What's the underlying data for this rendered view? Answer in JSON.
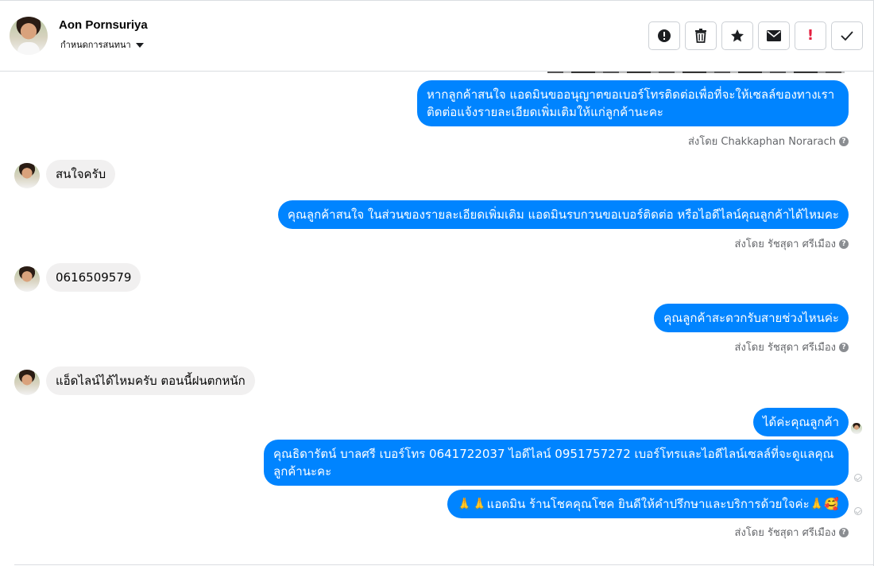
{
  "contact": {
    "name": "Aon Pornsuriya",
    "subtitle": "กำหนดการสนทนา"
  },
  "toolbar": {
    "buttons": [
      "alert-circle-icon",
      "trash-icon",
      "star-icon",
      "envelope-icon",
      "exclamation-icon",
      "check-icon"
    ],
    "exclamation_label": "!"
  },
  "colors": {
    "outgoing_bubble": "#0084ff",
    "incoming_bubble": "#f1f0f0",
    "exclamation": "#e41e3f"
  },
  "messages": [
    {
      "direction": "out",
      "text": "หากลูกค้าสนใจ แอดมินขออนุญาตขอเบอร์โทรติดต่อเพื่อที่จะให้เซลล์ของทางเรา ติดต่อแจ้งรายละเอียดเพิ่มเติมให้แก่ลูกค้านะคะ"
    },
    {
      "direction": "in",
      "text": "สนใจครับ"
    },
    {
      "direction": "out",
      "text": "คุณลูกค้าสนใจ ในส่วนของรายละเอียดเพิ่มเติม แอดมินรบกวนขอเบอร์ติดต่อ หรือไอดีไลน์คุณลูกค้าได้ไหมคะ"
    },
    {
      "direction": "in",
      "text": "0616509579"
    },
    {
      "direction": "out",
      "text": "คุณลูกค้าสะดวกรับสายช่วงไหนค่ะ"
    },
    {
      "direction": "in",
      "text": "แอ็ดไลน์ได้ไหมครับ  ตอนนี้ฝนตกหนัก"
    },
    {
      "direction": "out",
      "text": "ได้ค่ะคุณลูกค้า"
    },
    {
      "direction": "out",
      "text": "คุณธิดารัตน์ บาลศรี เบอร์โทร 0641722037  ไอดีไลน์ 0951757272   เบอร์โทรและไอดีไลน์เซลล์ที่จะดูแลคุณลูกค้านะคะ"
    },
    {
      "direction": "out",
      "text": "🙏🙏แอดมิน ร้านโชคคุณโชค ยินดีให้คำปรึกษาและบริการด้วยใจค่ะ🙏🥰"
    }
  ],
  "sent_by": [
    "ส่งโดย Chakkaphan Norarach",
    "ส่งโดย รัชสุดา ศรีเมือง",
    "ส่งโดย รัชสุดา ศรีเมือง",
    "ส่งโดย รัชสุดา ศรีเมือง"
  ],
  "help_glyph": "?"
}
